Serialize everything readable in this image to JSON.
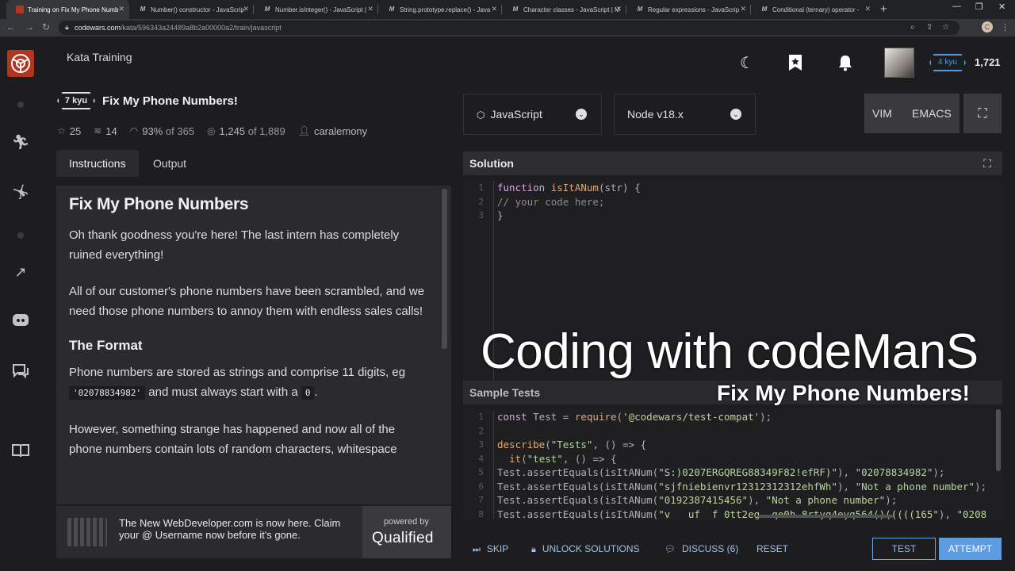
{
  "browser": {
    "tabs": [
      {
        "label": "Training on Fix My Phone Numb",
        "fav": "",
        "active": true
      },
      {
        "label": "Number() constructor - JavaScrip",
        "fav": "M"
      },
      {
        "label": "Number.isInteger() - JavaScript |",
        "fav": "M"
      },
      {
        "label": "String.prototype.replace() - Java",
        "fav": "M"
      },
      {
        "label": "Character classes - JavaScript | M",
        "fav": "M"
      },
      {
        "label": "Regular expressions - JavaScrip",
        "fav": "M"
      },
      {
        "label": "Conditional (ternary) operator -",
        "fav": "M"
      }
    ],
    "url_domain": "codewars.com",
    "url_path": "/kata/596343a24489a8b2a00000a2/train/javascript",
    "profile_initial": "C"
  },
  "header": {
    "title": "Kata Training",
    "rank": "4 kyu",
    "honor": "1,721"
  },
  "kata": {
    "kyu": "7 kyu",
    "title": "Fix My Phone Numbers!",
    "stars": "25",
    "collections": "14",
    "satisfaction": "93%",
    "satisfaction_of": "of 365",
    "completed": "1,245",
    "completed_of": "of 1,889",
    "author": "caralemony"
  },
  "tabs": {
    "instructions": "Instructions",
    "output": "Output"
  },
  "description": {
    "heading": "Fix My Phone Numbers",
    "p1": "Oh thank goodness you're here! The last intern has completely ruined everything!",
    "p2": "All of our customer's phone numbers have been scrambled, and we need those phone numbers to annoy them with endless sales calls!",
    "h2": "The Format",
    "p3_a": "Phone numbers are stored as strings and comprise 11 digits, eg",
    "p3_code1": "'02078834982'",
    "p3_b": "and must always start with a",
    "p3_code2": "0",
    "p3_c": ".",
    "p4": "However, something strange has happened and now all of the phone numbers contain lots of random characters, whitespace"
  },
  "promo": {
    "message": "The New WebDeveloper.com is now here. Claim your @ Username now before it's gone.",
    "powered": "powered by",
    "brand": "Qualified"
  },
  "editor_controls": {
    "language": "JavaScript",
    "runtime": "Node v18.x",
    "vim": "VIM",
    "emacs": "EMACS"
  },
  "solution": {
    "label": "Solution",
    "lines": [
      {
        "n": "1",
        "parts": [
          [
            "kw",
            "function "
          ],
          [
            "fn",
            "isItANum"
          ],
          [
            "",
            "(str) {"
          ]
        ]
      },
      {
        "n": "2",
        "parts": [
          [
            "cm",
            "// your code here;"
          ]
        ]
      },
      {
        "n": "3",
        "parts": [
          [
            "",
            "}"
          ]
        ]
      }
    ]
  },
  "tests": {
    "label": "Sample Tests",
    "lines": [
      {
        "n": "1",
        "parts": [
          [
            "kw",
            "const "
          ],
          [
            "",
            "Test = "
          ],
          [
            "fn",
            "require"
          ],
          [
            "",
            "("
          ],
          [
            "str",
            "'@codewars/test-compat'"
          ],
          [
            "",
            ");"
          ]
        ]
      },
      {
        "n": "2",
        "parts": []
      },
      {
        "n": "3",
        "parts": [
          [
            "fn",
            "describe"
          ],
          [
            "",
            "("
          ],
          [
            "str",
            "\"Tests\""
          ],
          [
            "",
            ", () => {"
          ]
        ]
      },
      {
        "n": "4",
        "parts": [
          [
            "",
            "  "
          ],
          [
            "fn",
            "it"
          ],
          [
            "",
            "("
          ],
          [
            "str",
            "\"test\""
          ],
          [
            "",
            ", () => {"
          ]
        ]
      },
      {
        "n": "5",
        "parts": [
          [
            "",
            "Test.assertEquals(isItANum("
          ],
          [
            "str",
            "\"S:)0207ERGQREG88349F82!efRF)\""
          ],
          [
            "",
            "), "
          ],
          [
            "str",
            "\"02078834982\""
          ],
          [
            "",
            ");"
          ]
        ]
      },
      {
        "n": "6",
        "parts": [
          [
            "",
            "Test.assertEquals(isItANum("
          ],
          [
            "str",
            "\"sjfniebienvr12312312312ehfWh\""
          ],
          [
            "",
            "), "
          ],
          [
            "str",
            "\"Not a phone number\""
          ],
          [
            "",
            ");"
          ]
        ]
      },
      {
        "n": "7",
        "parts": [
          [
            "",
            "Test.assertEquals(isItANum("
          ],
          [
            "str",
            "\"0192387415456\""
          ],
          [
            "",
            "), "
          ],
          [
            "str",
            "\"Not a phone number\""
          ],
          [
            "",
            ");"
          ]
        ]
      },
      {
        "n": "8",
        "parts": [
          [
            "",
            "Test.assertEquals(isItANum("
          ],
          [
            "str",
            "\"v   uf  f 0tt2eg  qe0b 8rtyq4eyq564()(((((165\""
          ],
          [
            "",
            "), "
          ],
          [
            "str",
            "\"0208"
          ]
        ]
      }
    ]
  },
  "overlay": {
    "line1": "Coding with codeManS",
    "line2": "Fix My Phone Numbers!"
  },
  "actions": {
    "skip": "SKIP",
    "unlock": "UNLOCK SOLUTIONS",
    "discuss": "DISCUSS (6)",
    "reset": "RESET",
    "test": "TEST",
    "attempt": "ATTEMPT"
  }
}
